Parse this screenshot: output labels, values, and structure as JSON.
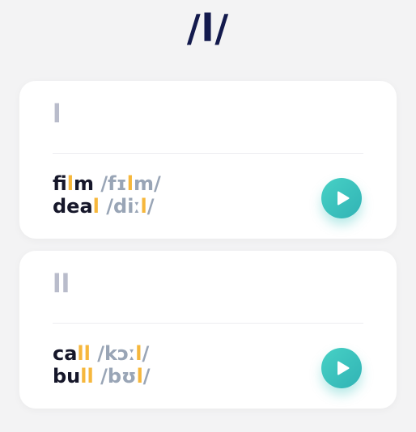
{
  "header": {
    "title": "/l/"
  },
  "cards": [
    {
      "spelling": "l",
      "examples": [
        {
          "w1": "fi",
          "hl": "l",
          "w2": "m",
          "ipa1": " /fɪ",
          "ipa_hl": "l",
          "ipa2": "m/"
        },
        {
          "w1": "dea",
          "hl": "l",
          "w2": "",
          "ipa1": " /diː",
          "ipa_hl": "l",
          "ipa2": "/"
        }
      ]
    },
    {
      "spelling": "ll",
      "examples": [
        {
          "w1": "ca",
          "hl": "ll",
          "w2": "",
          "ipa1": " /kɔː",
          "ipa_hl": "l",
          "ipa2": "/"
        },
        {
          "w1": "bu",
          "hl": "ll",
          "w2": "",
          "ipa1": " /bʊ",
          "ipa_hl": "l",
          "ipa2": "/"
        }
      ]
    }
  ],
  "colors": {
    "title": "#131a4d",
    "highlight": "#f6b73c",
    "ipa": "#99a5b6",
    "play_button": "#3cc2bd"
  },
  "icons": {
    "play": "play-icon"
  }
}
